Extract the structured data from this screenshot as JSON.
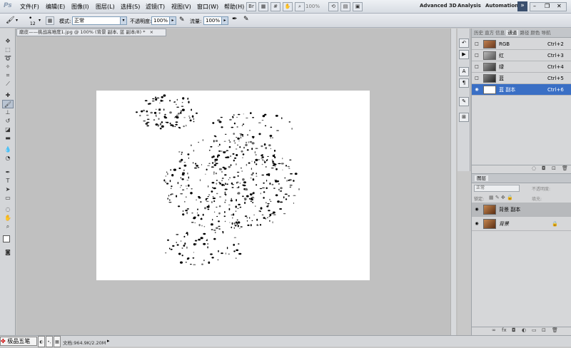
{
  "menubar": {
    "logo": "Ps",
    "items": [
      "文件(F)",
      "编辑(E)",
      "图像(I)",
      "图层(L)",
      "选择(S)",
      "滤镜(T)",
      "视图(V)",
      "窗口(W)",
      "帮助(H)"
    ],
    "zoom": "100%",
    "workspaces": [
      "Advanced 3D",
      "Analysis",
      "Automation"
    ],
    "more": "»"
  },
  "options": {
    "brush_size": "12",
    "mode_label": "模式:",
    "mode_value": "正常",
    "opacity_label": "不透明度:",
    "opacity_value": "100%",
    "flow_label": "流量:",
    "flow_value": "100%"
  },
  "document": {
    "tab_title": "磨皮——挑战高难度1.jpg @ 100% (背景 副本, 蓝 副本/8) *",
    "close_symbol": "×"
  },
  "channels": {
    "tabs": [
      "历史",
      "直方",
      "信息",
      "通道",
      "路径",
      "颜色",
      "导航"
    ],
    "rows": [
      {
        "name": "RGB",
        "shortcut": "Ctrl+2"
      },
      {
        "name": "红",
        "shortcut": "Ctrl+3"
      },
      {
        "name": "绿",
        "shortcut": "Ctrl+4"
      },
      {
        "name": "蓝",
        "shortcut": "Ctrl+5"
      },
      {
        "name": "蓝 副本",
        "shortcut": "Ctrl+6"
      }
    ]
  },
  "layers": {
    "title": "图层",
    "blend_mode": "正常",
    "opacity_label": "不透明度:",
    "lock_label": "锁定:",
    "fill_label": "填充:",
    "rows": [
      {
        "name": "背景 副本"
      },
      {
        "name": "背景"
      }
    ]
  },
  "statusbar": {
    "ime_label": "极品五笔",
    "doc_info": "文档:964.9K/2.20M"
  },
  "colors": {
    "selected": "#3a6fc5",
    "accent": "#2d63c0"
  }
}
